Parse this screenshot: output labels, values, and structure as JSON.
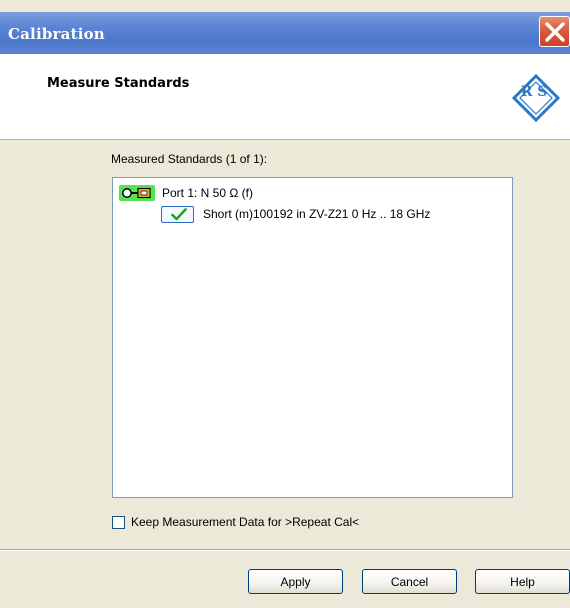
{
  "window": {
    "title": "Calibration"
  },
  "header": {
    "title": "Measure Standards",
    "logo_text": "R S"
  },
  "content": {
    "list_label": "Measured Standards (1 of 1):",
    "tree": {
      "port_label": "Port 1: N 50 Ω (f)",
      "standard_label": "Short (m)100192 in ZV-Z21  0 Hz  .. 18 GHz",
      "standard_status": "measured"
    },
    "keep_checkbox": {
      "label": "Keep Measurement Data for >Repeat Cal<",
      "checked": false
    }
  },
  "buttons": {
    "apply": "Apply",
    "cancel": "Cancel",
    "help": "Help"
  },
  "colors": {
    "titlebar": "#5b85d3",
    "close": "#d9573a",
    "port_icon": "#54e354",
    "check": "#1aa81a",
    "logo": "#2a78c8"
  }
}
